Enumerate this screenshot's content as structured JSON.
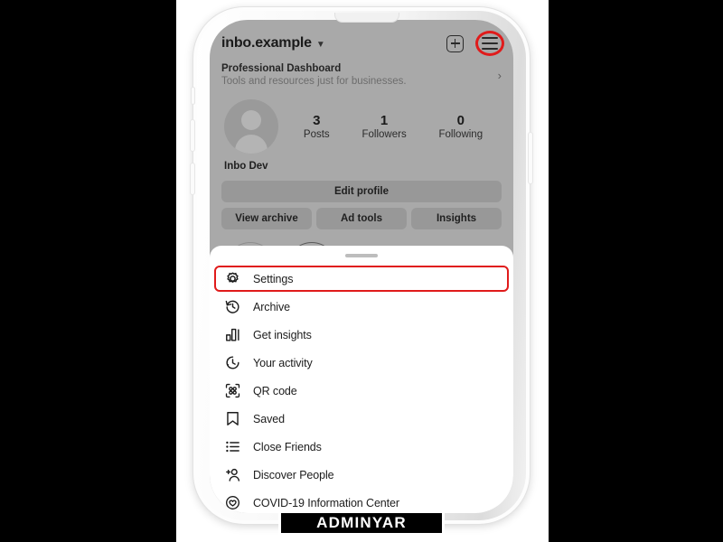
{
  "profile": {
    "username": "inbo.example",
    "caret": "chevron-down",
    "dashboard": {
      "title": "Professional Dashboard",
      "subtitle": "Tools and resources just for businesses.",
      "chevron": "›"
    },
    "stats": [
      {
        "value": "3",
        "label": "Posts"
      },
      {
        "value": "1",
        "label": "Followers"
      },
      {
        "value": "0",
        "label": "Following"
      }
    ],
    "full_name": "Inbo Dev",
    "edit_profile_label": "Edit profile",
    "action_buttons": [
      {
        "label": "View archive"
      },
      {
        "label": "Ad tools"
      },
      {
        "label": "Insights"
      }
    ]
  },
  "sheet": {
    "items": [
      {
        "label": "Settings",
        "icon": "gear-icon",
        "highlighted": true
      },
      {
        "label": "Archive",
        "icon": "clock-rewind-icon",
        "highlighted": false
      },
      {
        "label": "Get insights",
        "icon": "bar-chart-icon",
        "highlighted": false
      },
      {
        "label": "Your activity",
        "icon": "clock-icon",
        "highlighted": false
      },
      {
        "label": "QR code",
        "icon": "qr-code-icon",
        "highlighted": false
      },
      {
        "label": "Saved",
        "icon": "bookmark-icon",
        "highlighted": false
      },
      {
        "label": "Close Friends",
        "icon": "list-icon",
        "highlighted": false
      },
      {
        "label": "Discover People",
        "icon": "person-add-icon",
        "highlighted": false
      },
      {
        "label": "COVID-19 Information Center",
        "icon": "heart-circle-icon",
        "highlighted": false
      }
    ]
  },
  "watermark": {
    "text": "ADMINYAR"
  },
  "colors": {
    "highlight": "#e01b1b",
    "dimmed_background": "#a9a9a9",
    "sheet_background": "#ffffff",
    "text": "#1c1c1c"
  }
}
